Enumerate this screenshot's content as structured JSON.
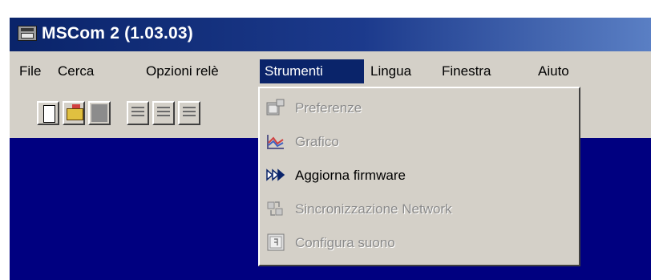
{
  "window": {
    "title": "MSCom 2 (1.03.03)"
  },
  "menubar": {
    "items": [
      {
        "label": "File"
      },
      {
        "label": "Cerca"
      },
      {
        "label": "Opzioni relè"
      },
      {
        "label": "Strumenti",
        "active": true
      },
      {
        "label": "Lingua"
      },
      {
        "label": "Finestra"
      },
      {
        "label": "Aiuto"
      }
    ]
  },
  "toolbar": {
    "buttons": [
      {
        "icon": "new-document-icon"
      },
      {
        "icon": "open-folder-icon"
      },
      {
        "icon": "save-icon"
      },
      {
        "icon": "align-icon"
      },
      {
        "icon": "list-icon"
      },
      {
        "icon": "toolbar-icon"
      }
    ]
  },
  "strumenti_menu": {
    "items": [
      {
        "label": "Preferenze",
        "icon": "preferences-icon",
        "enabled": false
      },
      {
        "label": "Grafico",
        "icon": "chart-icon",
        "enabled": false
      },
      {
        "label": "Aggiorna firmware",
        "icon": "fast-forward-icon",
        "enabled": true
      },
      {
        "label": "Sincronizzazione Network",
        "icon": "network-sync-icon",
        "enabled": false
      },
      {
        "label": "Configura suono",
        "icon": "sound-config-icon",
        "enabled": false
      }
    ]
  },
  "colors": {
    "title_bar": "#0a246a",
    "menu_highlight": "#0a246a",
    "client_background": "#000080",
    "face": "#d4d0c8",
    "disabled_text": "#8a8a8a"
  }
}
